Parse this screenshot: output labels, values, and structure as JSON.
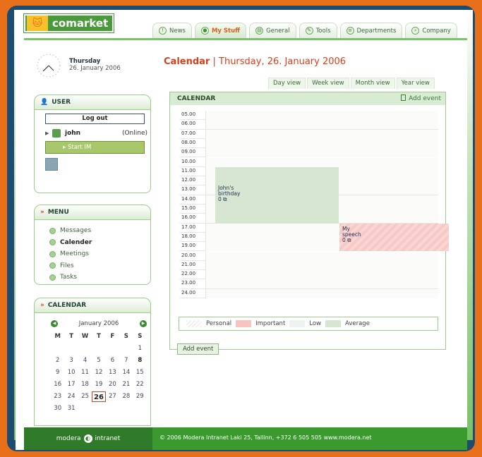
{
  "brand": {
    "name": "comarket"
  },
  "tabs": [
    {
      "label": "News",
      "icon": "info-icon"
    },
    {
      "label": "My Stuff",
      "icon": "person-icon"
    },
    {
      "label": "General",
      "icon": "document-icon"
    },
    {
      "label": "Tools",
      "icon": "tools-icon"
    },
    {
      "label": "Departments",
      "icon": "department-icon"
    },
    {
      "label": "Company",
      "icon": "search-icon"
    }
  ],
  "active_tab": "My Stuff",
  "date_widget": {
    "weekday": "Thursday",
    "date": "26. January 2006"
  },
  "user_box": {
    "title": "USER",
    "logout_label": "Log out",
    "user_name": "john",
    "user_status": "(Online)",
    "start_im_label": "Start IM"
  },
  "menu_box": {
    "title": "MENU",
    "items": [
      {
        "label": "Messages",
        "active": false
      },
      {
        "label": "Calender",
        "active": true
      },
      {
        "label": "Meetings",
        "active": false
      },
      {
        "label": "Files",
        "active": false
      },
      {
        "label": "Tasks",
        "active": false
      }
    ]
  },
  "calendar_box": {
    "title": "CALENDAR",
    "month_label": "January 2006",
    "weekday_headers": [
      "M",
      "T",
      "W",
      "T",
      "F",
      "S",
      "S"
    ],
    "leading_blanks": 6,
    "days": [
      "1",
      "2",
      "3",
      "4",
      "5",
      "6",
      "7",
      "8",
      "9",
      "10",
      "11",
      "12",
      "13",
      "14",
      "15",
      "16",
      "17",
      "18",
      "19",
      "20",
      "21",
      "22",
      "23",
      "24",
      "25",
      "26",
      "27",
      "28",
      "29",
      "30",
      "31"
    ],
    "bold_days": [
      "8",
      "26"
    ],
    "today": "26"
  },
  "main": {
    "title_bold": "Calendar",
    "title_sep": "|",
    "title_rest": "Thursday, 26. January 2006",
    "view_tabs": [
      "Day view",
      "Week view",
      "Month view",
      "Year view"
    ],
    "panel_title": "CALENDAR",
    "add_event_link": "Add event",
    "hours": [
      "05.00",
      "06.00",
      "07.00",
      "08.00",
      "09.00",
      "10.00",
      "11.00",
      "12.00",
      "13.00",
      "14.00",
      "15.00",
      "16.00",
      "17.00",
      "18.00",
      "19.00",
      "20.00",
      "21.00",
      "22.00",
      "23.00",
      "24.00"
    ],
    "events": [
      {
        "title_line1": "John's",
        "title_line2": "birthday",
        "meta": "0 ⧉",
        "category": "Average",
        "start": "11.00",
        "end": "17.00"
      },
      {
        "title_line1": "My",
        "title_line2": "speech",
        "meta": "0 ⧉",
        "category": "Important",
        "start": "17.00",
        "end": "20.00"
      }
    ],
    "legend": [
      {
        "label": "Personal",
        "key": "personal"
      },
      {
        "label": "Important",
        "key": "important"
      },
      {
        "label": "Low",
        "key": "low"
      },
      {
        "label": "Average",
        "key": "average"
      }
    ],
    "add_event_button": "Add event"
  },
  "footer": {
    "left_brand": "modera",
    "left_brand_suffix": "intranet",
    "text": "© 2006 Modera Intranet Laki 25, Tallinn, +372 6 505 505 www.modera.net"
  },
  "colors": {
    "accent_orange": "#d9401a",
    "brand_green": "#3a9a2e",
    "frame_blue": "#1e4b70"
  }
}
